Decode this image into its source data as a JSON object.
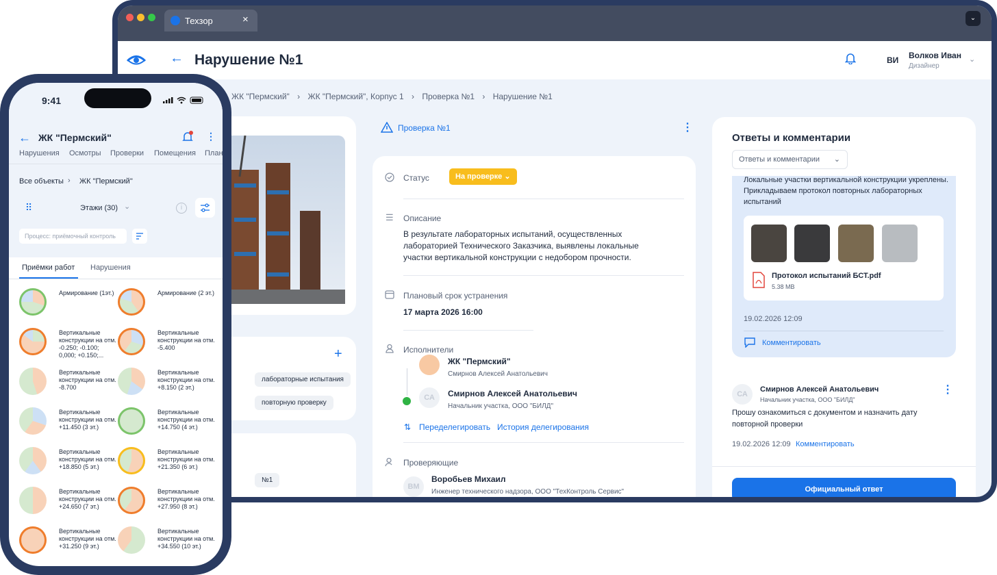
{
  "browser": {
    "tab_title": "Техзор",
    "close": "×",
    "expand": "⌄"
  },
  "header": {
    "back": "←",
    "title": "Нарушение №1",
    "initials": "ВИ",
    "user_name": "Волков Иван",
    "user_role": "Дизайнер",
    "chevron": "⌄"
  },
  "breadcrumb": [
    "ЖК \"Пермский\"",
    "ЖК \"Пермский\", Корпус 1",
    "Проверка №1",
    "Нарушение №1"
  ],
  "breadcrumb_sep": "›",
  "left_panel": {
    "plus": "+",
    "chip1": "лабораторные испытания",
    "chip2": "повторную проверку",
    "chip3": "№1"
  },
  "inspection_link": "Проверка №1",
  "kebab": "⋮",
  "details": {
    "status_label": "Статус",
    "status_value": "На проверке",
    "desc_label": "Описание",
    "desc_text": "В результате лабораторных испытаний, осуществленных лабораторией Технического Заказчика, выявлены локальные участки вертикальной конструкции с недобором прочности.",
    "deadline_label": "Плановый срок устранения",
    "deadline_value": "17 марта 2026 16:00",
    "executors_label": "Исполнители",
    "exec1_name": "ЖК \"Пермский\"",
    "exec1_sub": "Смирнов Алексей Анатольевич",
    "exec2_initials": "СА",
    "exec2_name": "Смирнов Алексей Анатольевич",
    "exec2_sub": "Начальник участка, ООО \"БИЛД\"",
    "redelegate": "Переделегировать",
    "history": "История делегирования",
    "reviewers_label": "Проверяющие",
    "rev_initials": "ВМ",
    "rev_name": "Воробьев Михаил",
    "rev_sub": "Инженер технического надзора, ООО \"ТехКонтроль Сервис\""
  },
  "comments": {
    "title": "Ответы и комментарии",
    "filter": "Ответы и комментарии",
    "msg1_text": "Локальные участки вертикальной конструкции укреплены. Прикладываем протокол повторных лабораторных испытаний",
    "file_name": "Протокол испытаний БСТ.pdf",
    "file_size": "5.38 MB",
    "msg1_time": "19.02.2026 12:09",
    "comment_btn": "Комментировать",
    "msg2_initials": "СА",
    "msg2_author": "Смирнов Алексей Анатольевич",
    "msg2_role": "Начальник участка, ООО \"БИЛД\"",
    "msg2_text": "Прошу ознакомиться с документом и назначить дату повторной проверки",
    "msg2_time": "19.02.2026 12:09",
    "msg2_comment": "Комментировать",
    "official": "Официальный ответ"
  },
  "phone": {
    "time": "9:41",
    "back": "←",
    "title": "ЖК \"Пермский\"",
    "kebab": "⋮",
    "tabs": [
      "Нарушения",
      "Осмотры",
      "Проверки",
      "Помещения",
      "Планы"
    ],
    "crumb1": "Все объекты",
    "crumb_sep": "›",
    "crumb2": "ЖК \"Пермский\"",
    "floors": "Этажи (30)",
    "floors_chev": "⌄",
    "info": "i",
    "process_placeholder": "Процесс: приёмочный контроль",
    "subtab1": "Приёмки работ",
    "subtab2": "Нарушения",
    "items": [
      [
        "Армирование (1эт.)",
        "Армирование (2 эт.)"
      ],
      [
        "Вертикальные конструкции на отм. -0.250; -0.100; 0,000; +0.150;...",
        "Вертикальные конструкции на отм. -5.400"
      ],
      [
        "Вертикальные конструкции на отм. -8.700",
        "Вертикальные конструкции на отм. +8.150 (2 эт.)"
      ],
      [
        "Вертикальные конструкции на отм. +11.450 (3 эт.)",
        "Вертикальные конструкции на отм. +14.750 (4 эт.)"
      ],
      [
        "Вертикальные конструкции на отм. +18.850 (5 эт.)",
        "Вертикальные конструкции на отм. +21.350 (6 эт.)"
      ],
      [
        "Вертикальные конструкции на отм. +24.650 (7 эт.)",
        "Вертикальные конструкции на отм. +27.950 (8 эт.)"
      ],
      [
        "Вертикальные конструкции на отм. +31.250 (9 эт.)",
        "Вертикальные конструкции на отм. +34.550 (10 эт.)"
      ]
    ]
  },
  "colors": {
    "accent": "#1a73e8",
    "status": "#f8bd1d",
    "frame": "#2a3b61",
    "green": "#2fb344",
    "orange": "#ef7d2c"
  }
}
